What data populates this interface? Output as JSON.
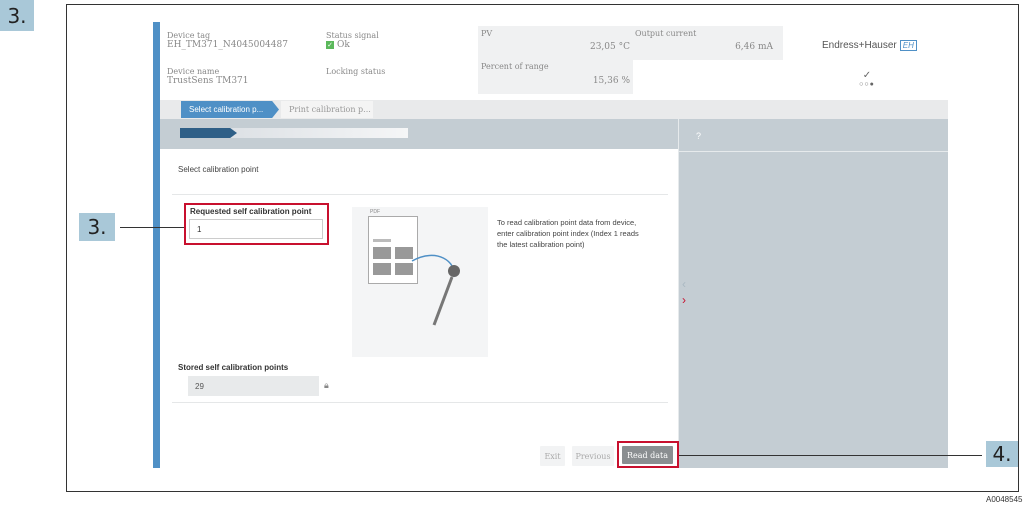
{
  "step_outer": "3.",
  "header": {
    "device_tag_label": "Device tag",
    "device_tag_value": "EH_TM371_N4045004487",
    "status_label": "Status signal",
    "status_value": "Ok",
    "device_name_label": "Device name",
    "device_name_value": "TrustSens TM371",
    "locking_label": "Locking status",
    "pv_label": "PV",
    "pv_value": "23,05 °C",
    "output_label": "Output current",
    "output_value": "6,46 mA",
    "percent_label": "Percent of range",
    "percent_value": "15,36 %",
    "brand": "Endress+Hauser",
    "brand_mark": "EH",
    "accent_green": "#5bb85b"
  },
  "tabs": {
    "active": "Select calibration p...",
    "inactive": "Print calibration p..."
  },
  "progress": {
    "fraction": 0.25
  },
  "content": {
    "title": "Select calibration point",
    "requested_label": "Requested self calibration point",
    "requested_value": "1",
    "pdf_label": "PDF",
    "help_text": "To read calibration point data from device, enter calibration point index (Index 1 reads the latest calibration point)",
    "stored_label": "Stored self calibration points",
    "stored_value": "29"
  },
  "help_panel": {
    "title": "?"
  },
  "buttons": {
    "exit": "Exit",
    "previous": "Previous",
    "read": "Read data"
  },
  "callouts": {
    "left": "3.",
    "right": "4."
  },
  "footer_code": "A0048545",
  "colors": {
    "accent_blue": "#4f90c6",
    "highlight_red": "#c8102e",
    "callout_bg": "#a9c8d8"
  }
}
